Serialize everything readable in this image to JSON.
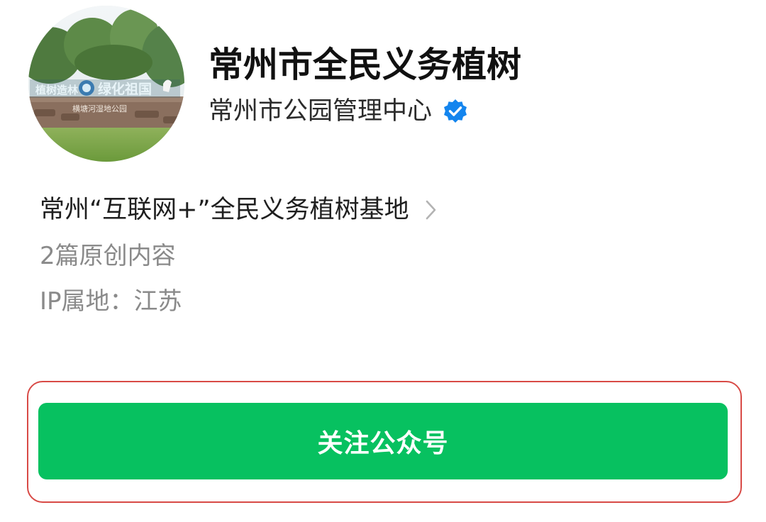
{
  "profile": {
    "avatar_icon": "park-sign-photo",
    "avatar_sign": {
      "left_text": "植树造林",
      "right_text": "绿化祖国",
      "lower_text": "横塘河湿地公园"
    },
    "name": "常州市全民义务植树",
    "owner": "常州市公园管理中心",
    "verified_icon": "verified-badge-icon",
    "verified_color": "#1485ee"
  },
  "details": {
    "base_name": "常州“互联网+”全民义务植树基地",
    "base_chevron_icon": "chevron-right-icon",
    "article_count": "2篇原创内容",
    "ip_location": "IP属地：江苏"
  },
  "actions": {
    "follow_label": "关注公众号",
    "follow_color": "#07c160",
    "frame_color": "#d84a46"
  }
}
